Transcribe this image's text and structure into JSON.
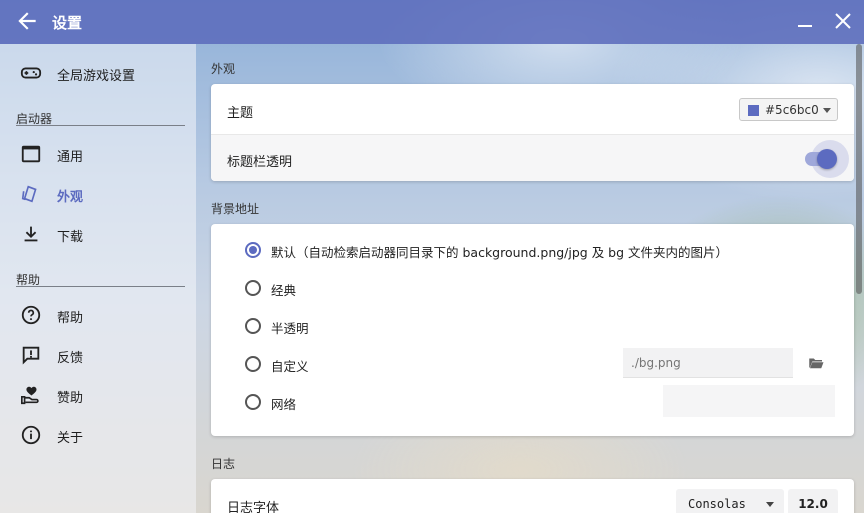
{
  "window": {
    "title": "设置"
  },
  "sidebar": {
    "global_game_settings": "全局游戏设置",
    "groups": {
      "launcher": "启动器",
      "help": "帮助"
    },
    "items": {
      "general": "通用",
      "appearance": "外观",
      "download": "下载",
      "help": "帮助",
      "feedback": "反馈",
      "sponsor": "赞助",
      "about": "关于"
    },
    "active_item": "外观"
  },
  "appearance": {
    "section_title": "外观",
    "theme": {
      "label": "主题",
      "color_text": "#5c6bc0",
      "color_value": "#5c6bc0"
    },
    "titlebar_transparent": {
      "label": "标题栏透明",
      "checked": true
    }
  },
  "background": {
    "section_title": "背景地址",
    "options": {
      "default": "默认（自动检索启动器同目录下的 background.png/jpg 及 bg 文件夹内的图片）",
      "classic": "经典",
      "translucent": "半透明",
      "custom": "自定义",
      "network": "网络"
    },
    "selected": "default",
    "custom_path_placeholder": "./bg.png",
    "network_url_value": ""
  },
  "logs": {
    "section_title": "日志",
    "font_label": "日志字体",
    "font_family": "Consolas",
    "font_size": "12.0"
  },
  "colors": {
    "accent": "#5c6bc0",
    "accent_light": "#9fa8da"
  }
}
